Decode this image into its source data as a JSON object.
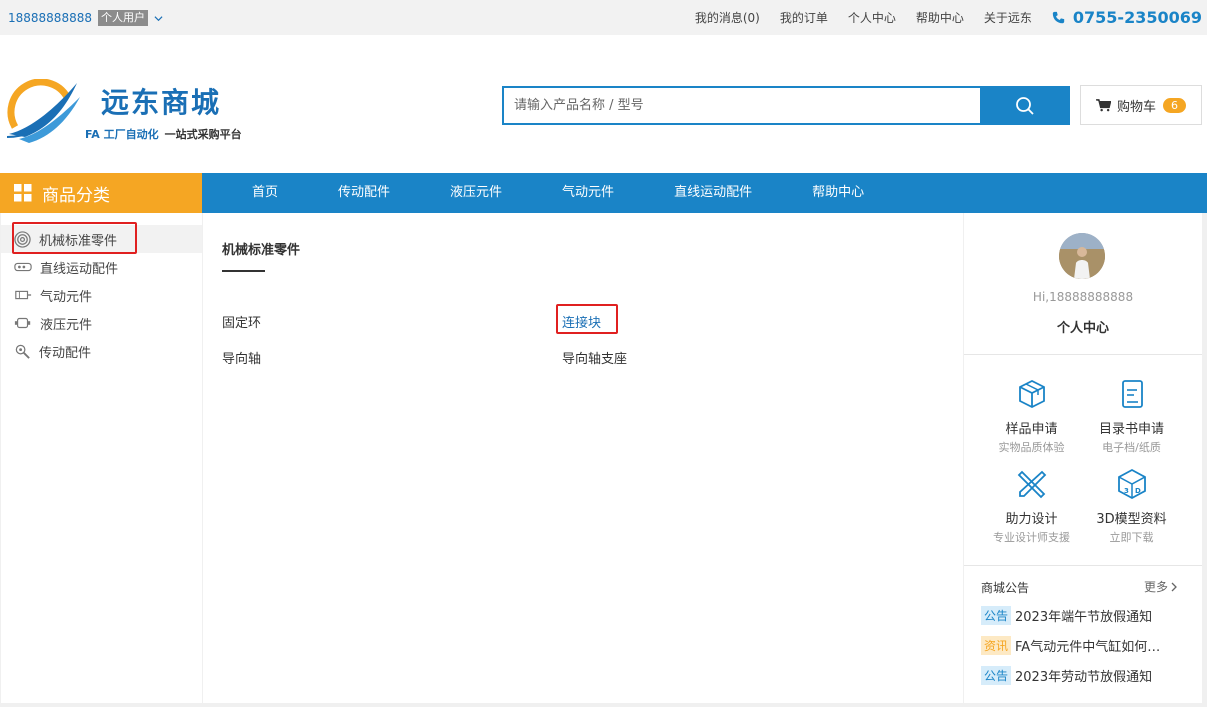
{
  "topbar": {
    "phone": "18888888888",
    "user_type": "个人用户",
    "links": [
      "我的消息(0)",
      "我的订单",
      "个人中心",
      "帮助中心",
      "关于远东"
    ],
    "hotline": "0755-2350069"
  },
  "header": {
    "brand": "远东商城",
    "slogan_a": "FA 工厂自动化",
    "slogan_b": "一站式采购平台",
    "search_placeholder": "请输入产品名称 / 型号",
    "cart_label": "购物车",
    "cart_count": "6"
  },
  "nav": {
    "category_title": "商品分类",
    "items": [
      "首页",
      "传动配件",
      "液压元件",
      "气动元件",
      "直线运动配件",
      "帮助中心"
    ]
  },
  "categories": [
    "机械标准零件",
    "直线运动配件",
    "气动元件",
    "液压元件",
    "传动配件"
  ],
  "middle": {
    "title": "机械标准零件",
    "products": [
      "固定环",
      "连接块",
      "导向轴",
      "导向轴支座"
    ]
  },
  "user_panel": {
    "greeting": "Hi,18888888888",
    "center": "个人中心",
    "services": [
      {
        "title": "样品申请",
        "sub": "实物品质体验",
        "icon": "box-icon"
      },
      {
        "title": "目录书申请",
        "sub": "电子档/纸质",
        "icon": "book-icon"
      },
      {
        "title": "助力设计",
        "sub": "专业设计师支援",
        "icon": "design-tools-icon"
      },
      {
        "title": "3D模型资料",
        "sub": "立即下载",
        "icon": "3d-cube-icon"
      }
    ]
  },
  "notices": {
    "title": "商城公告",
    "more": "更多",
    "items": [
      {
        "tag": "公告",
        "text": "2023年端午节放假通知"
      },
      {
        "tag": "资讯",
        "text": "FA气动元件中气缸如何…"
      },
      {
        "tag": "公告",
        "text": "2023年劳动节放假通知"
      }
    ]
  },
  "colors": {
    "primary": "#1a84c7",
    "accent": "#f5a623",
    "highlight": "#e02020"
  }
}
